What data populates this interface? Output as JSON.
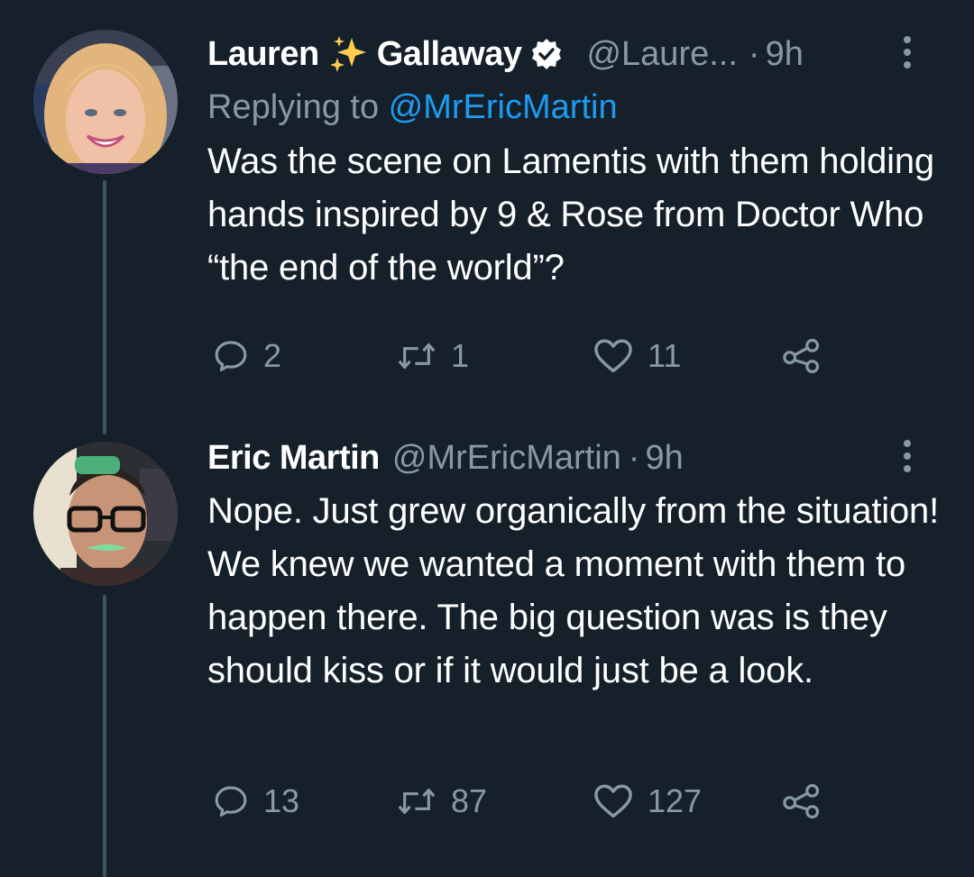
{
  "tweets": [
    {
      "name_first": "Lauren",
      "name_emoji": "sparkles-emoji",
      "name_last": "Gallaway",
      "verified": true,
      "handle": "@Laure...",
      "separator": "·",
      "time": "9h",
      "replying_prefix": "Replying to ",
      "replying_to": "@MrEricMartin",
      "text": "Was the scene on Lamentis with them holding hands inspired by 9 & Rose from Doctor Who “the end of the world”?",
      "counts": {
        "replies": "2",
        "retweets": "1",
        "likes": "11"
      }
    },
    {
      "name": "Eric Martin",
      "handle": "@MrEricMartin",
      "separator": "·",
      "time": "9h",
      "text": "Nope. Just grew organically from the situation! We knew we wanted a moment with them to happen there. The big question was is they should kiss or if it would just be a look.",
      "counts": {
        "replies": "13",
        "retweets": "87",
        "likes": "127"
      }
    }
  ],
  "icons": {
    "reply": "reply-icon",
    "retweet": "retweet-icon",
    "like": "heart-icon",
    "share": "share-icon",
    "more": "more-vertical-icon",
    "verified": "verified-badge-icon"
  },
  "colors": {
    "background": "#15202b",
    "text": "#ffffff",
    "secondary": "#8899a6",
    "link": "#1d9bf0",
    "thread_line": "#3d5466"
  }
}
